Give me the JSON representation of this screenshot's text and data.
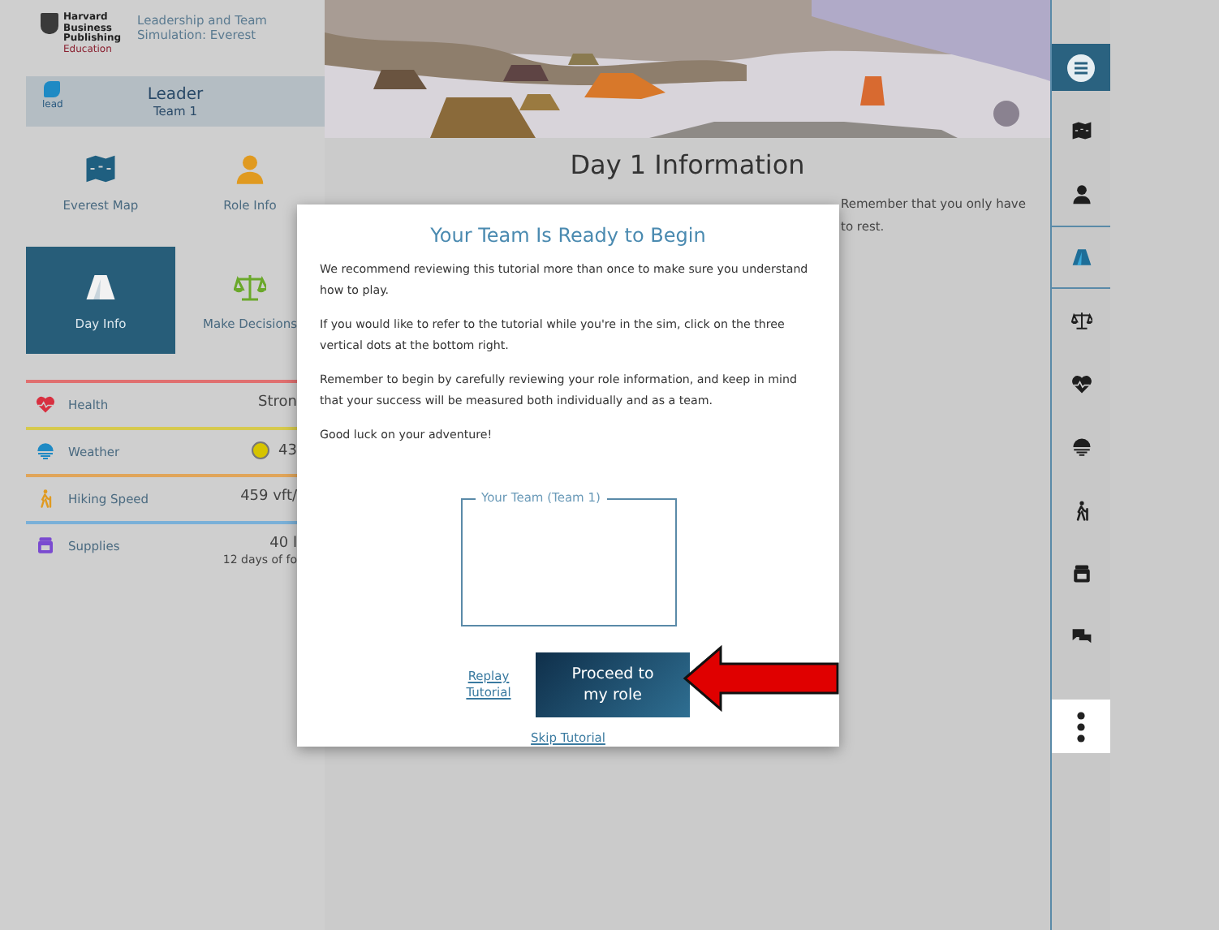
{
  "header": {
    "publisher": [
      "Harvard",
      "Business",
      "Publishing",
      "Education"
    ],
    "title": "Leadership and Team Simulation: Everest"
  },
  "role": {
    "badge": "lead",
    "name": "Leader",
    "team": "Team 1"
  },
  "tiles": [
    {
      "label": "Everest Map",
      "selected": false
    },
    {
      "label": "Role Info",
      "selected": false
    },
    {
      "label": "Day Info",
      "selected": true
    },
    {
      "label": "Make Decisions",
      "selected": false
    }
  ],
  "stats": [
    {
      "label": "Health",
      "value": "Stron",
      "color": "#e07070"
    },
    {
      "label": "Weather",
      "value": "43",
      "color": "#d6c94e",
      "sun": true
    },
    {
      "label": "Hiking Speed",
      "value": "459 vft/",
      "color": "#e0a55a"
    },
    {
      "label": "Supplies",
      "value": "40 l",
      "note": "12 days of fo",
      "color": "#7ab0d8"
    }
  ],
  "page": {
    "title": "Day 1 Information",
    "text_lines": [
      "Remember that you only have",
      "to rest."
    ]
  },
  "rail": [
    {
      "kind": "menu"
    },
    {
      "kind": "nav",
      "selected": false
    },
    {
      "kind": "nav",
      "selected": false
    },
    {
      "kind": "nav",
      "selected": true
    },
    {
      "kind": "nav",
      "selected": false
    },
    {
      "kind": "nav",
      "selected": false
    },
    {
      "kind": "nav",
      "selected": false
    },
    {
      "kind": "nav",
      "selected": false
    },
    {
      "kind": "nav",
      "selected": false
    },
    {
      "kind": "nav",
      "selected": false
    },
    {
      "kind": "more"
    }
  ],
  "dialog": {
    "title": "Your Team Is Ready to Begin",
    "paragraphs": [
      "We recommend reviewing this tutorial more than once to make sure you understand how to play.",
      "If you would like to refer to the tutorial while you're in the sim, click on the three vertical dots at the bottom right.",
      "Remember to begin by carefully reviewing your role information, and keep in mind that your success will be measured both individually and as a team.",
      "Good luck on your adventure!"
    ],
    "team_box": {
      "legend": "Your Team (Team 1)"
    },
    "replay_link": "Replay Tutorial",
    "proceed_button": "Proceed to my role",
    "skip_link": "Skip Tutorial"
  }
}
